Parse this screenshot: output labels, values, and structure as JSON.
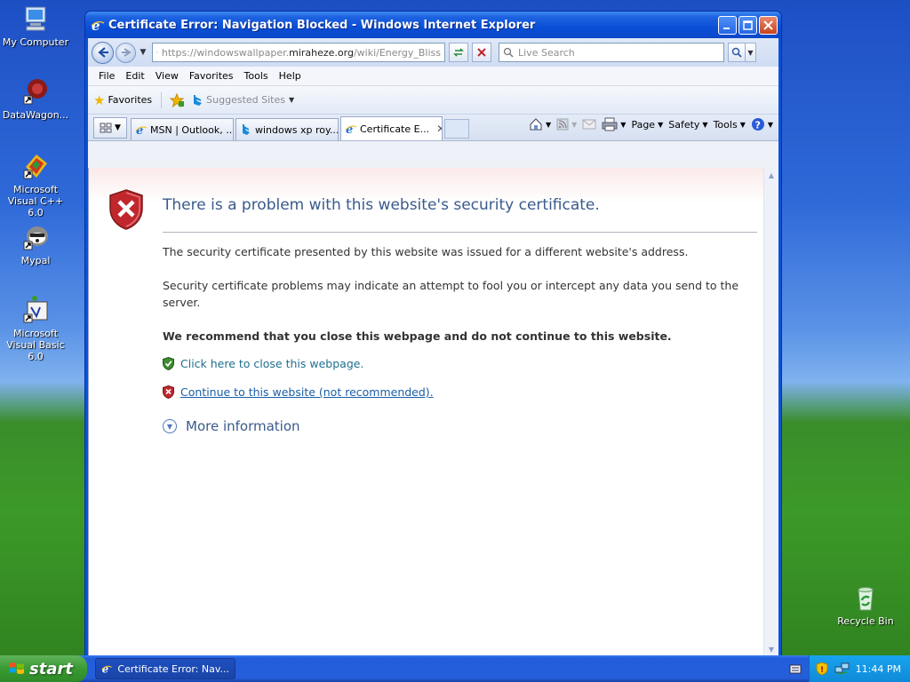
{
  "desktop": {
    "icons": [
      {
        "label": "My Computer",
        "icon": "computer-icon"
      },
      {
        "label": "DataWagon...",
        "icon": "datawagon-icon"
      },
      {
        "label": "Microsoft Visual C++ 6.0",
        "icon": "visual-cpp-icon"
      },
      {
        "label": "Mypal",
        "icon": "mypal-icon"
      },
      {
        "label": "Microsoft Visual Basic 6.0",
        "icon": "visual-basic-icon"
      },
      {
        "label": "Recycle Bin",
        "icon": "recycle-bin-icon"
      }
    ]
  },
  "window": {
    "title": "Certificate Error: Navigation Blocked - Windows Internet Explorer",
    "address": {
      "prefix": "https://windowswallpaper.",
      "domain": "miraheze.org",
      "suffix": "/wiki/Energy_Bliss"
    },
    "search_placeholder": "Live Search",
    "menu": [
      "File",
      "Edit",
      "View",
      "Favorites",
      "Tools",
      "Help"
    ],
    "favorites_label": "Favorites",
    "suggested_sites": "Suggested Sites",
    "tabs": [
      {
        "label": "MSN | Outlook, ...",
        "icon": "ie-icon"
      },
      {
        "label": "windows xp roy...",
        "icon": "bing-icon"
      },
      {
        "label": "Certificate E...",
        "icon": "ie-icon",
        "active": true
      }
    ],
    "commands": {
      "page": "Page",
      "safety": "Safety",
      "tools": "Tools"
    }
  },
  "content": {
    "heading": "There is a problem with this website's security certificate.",
    "para1": "The security certificate presented by this website was issued for a different website's address.",
    "para2": "Security certificate problems may indicate an attempt to fool you or intercept any data you send to the server.",
    "recommend": "We recommend that you close this webpage and do not continue to this website.",
    "close_link": "Click here to close this webpage.",
    "continue_link": "Continue to this website (not recommended).",
    "more_info": "More information"
  },
  "taskbar": {
    "start": "start",
    "task_button": "Certificate Error: Nav...",
    "clock": "11:44 PM"
  },
  "colors": {
    "heading": "#3a5a8c",
    "link": "#1a5fa8",
    "error_red": "#c0272d",
    "ok_green": "#3d8b2f"
  }
}
